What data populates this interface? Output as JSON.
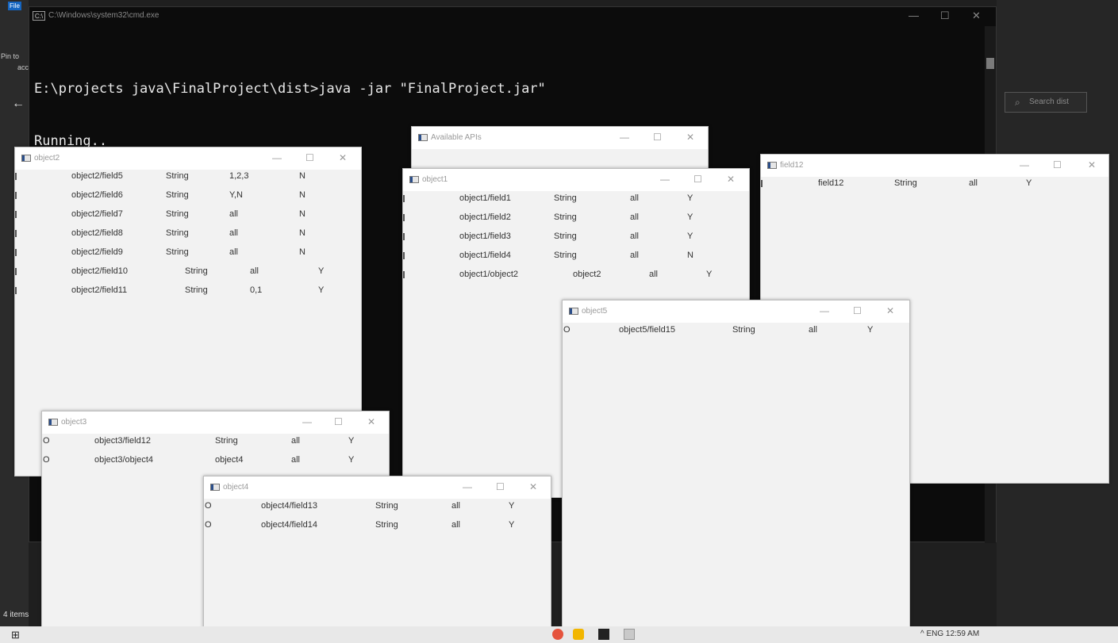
{
  "explorer": {
    "file_tab": "File",
    "pin_text": "Pin to",
    "pin_text2": "acc",
    "back_arrow": "←",
    "search_placeholder": "Search dist",
    "status_items": "4 items"
  },
  "cmd": {
    "title": "C:\\Windows\\system32\\cmd.exe",
    "icon_text": "C:\\",
    "lines": [
      "E:\\projects java\\FinalProject\\dist>java -jar \"FinalProject.jar\"",
      "Running.."
    ],
    "minimize": "—",
    "maximize": "☐",
    "close": "✕"
  },
  "windows": {
    "available_apis": {
      "title": "Available APIs"
    },
    "object2": {
      "title": "object2",
      "rows": [
        [
          "object2/field5",
          "String",
          "1,2,3",
          "N"
        ],
        [
          "object2/field6",
          "String",
          "Y,N",
          "N"
        ],
        [
          "object2/field7",
          "String",
          "all",
          "N"
        ],
        [
          "object2/field8",
          "String",
          "all",
          "N"
        ],
        [
          "object2/field9",
          "String",
          "all",
          "N"
        ],
        [
          "object2/field10",
          "String",
          "all",
          "Y"
        ],
        [
          "object2/field11",
          "String",
          "0,1",
          "Y"
        ]
      ]
    },
    "object1": {
      "title": "object1",
      "rows": [
        [
          "object1/field1",
          "String",
          "all",
          "Y"
        ],
        [
          "object1/field2",
          "String",
          "all",
          "Y"
        ],
        [
          "object1/field3",
          "String",
          "all",
          "Y"
        ],
        [
          "object1/field4",
          "String",
          "all",
          "N"
        ],
        [
          "object1/object2",
          "object2",
          "all",
          "Y"
        ]
      ]
    },
    "field12": {
      "title": "field12",
      "rows": [
        [
          "field12",
          "String",
          "all",
          "Y"
        ]
      ]
    },
    "object5": {
      "title": "object5",
      "rows": [
        [
          "O",
          "object5/field15",
          "String",
          "all",
          "Y"
        ]
      ]
    },
    "object3": {
      "title": "object3",
      "rows": [
        [
          "O",
          "object3/field12",
          "String",
          "all",
          "Y"
        ],
        [
          "O",
          "object3/object4",
          "object4",
          "all",
          "Y"
        ]
      ]
    },
    "object4": {
      "title": "object4",
      "rows": [
        [
          "O",
          "object4/field13",
          "String",
          "all",
          "Y"
        ],
        [
          "O",
          "object4/field14",
          "String",
          "all",
          "Y"
        ]
      ]
    },
    "controls": {
      "minimize": "—",
      "maximize": "☐",
      "close": "✕"
    }
  },
  "taskbar": {
    "start_icon": "⊞",
    "tray_text": "^  ENG  12:59 AM"
  },
  "colors": {
    "cmd_bg": "#0c0c0c",
    "window_bg": "#f2f2f2",
    "taskbar_bg": "#e8e8e8"
  }
}
